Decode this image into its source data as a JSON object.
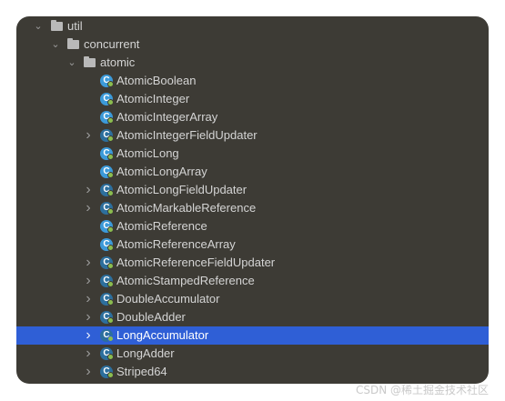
{
  "tree": {
    "util": "util",
    "concurrent": "concurrent",
    "atomic": "atomic",
    "classes": [
      {
        "name": "AtomicBoolean",
        "expandable": false
      },
      {
        "name": "AtomicInteger",
        "expandable": false
      },
      {
        "name": "AtomicIntegerArray",
        "expandable": false
      },
      {
        "name": "AtomicIntegerFieldUpdater",
        "expandable": true
      },
      {
        "name": "AtomicLong",
        "expandable": false
      },
      {
        "name": "AtomicLongArray",
        "expandable": false
      },
      {
        "name": "AtomicLongFieldUpdater",
        "expandable": true
      },
      {
        "name": "AtomicMarkableReference",
        "expandable": true
      },
      {
        "name": "AtomicReference",
        "expandable": false
      },
      {
        "name": "AtomicReferenceArray",
        "expandable": false
      },
      {
        "name": "AtomicReferenceFieldUpdater",
        "expandable": true
      },
      {
        "name": "AtomicStampedReference",
        "expandable": true
      },
      {
        "name": "DoubleAccumulator",
        "expandable": true
      },
      {
        "name": "DoubleAdder",
        "expandable": true
      },
      {
        "name": "LongAccumulator",
        "expandable": true,
        "selected": true
      },
      {
        "name": "LongAdder",
        "expandable": true
      },
      {
        "name": "Striped64",
        "expandable": true
      }
    ],
    "class_icon_glyph": "C",
    "folder_icon": "folder-icon",
    "class_icon": "class-icon"
  },
  "watermark": "CSDN @稀土掘金技术社区",
  "colors": {
    "panel_bg": "#3d3b35",
    "selection": "#2f5fd6",
    "class_icon": "#3c9ad9"
  }
}
